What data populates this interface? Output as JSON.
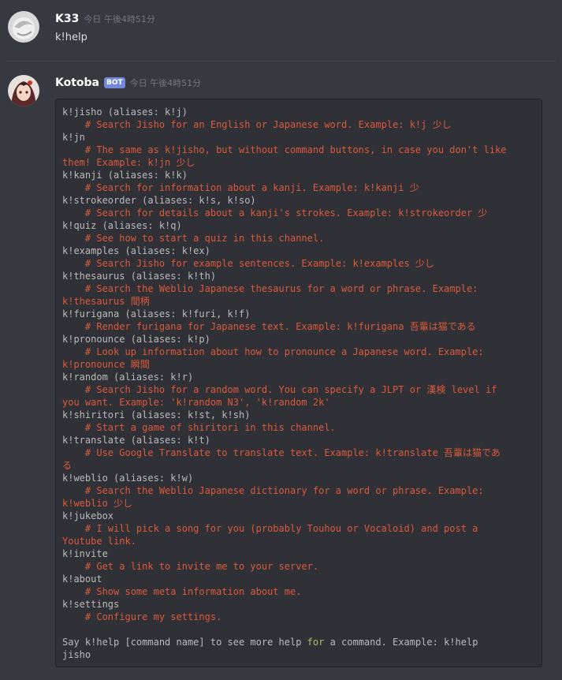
{
  "messages": [
    {
      "username": "K33",
      "timestamp": "今日 午後4時51分",
      "text": "k!help"
    },
    {
      "username": "Kotoba",
      "bot_tag": "BOT",
      "timestamp": "今日 午後4時51分"
    }
  ],
  "help": {
    "commands": [
      {
        "cmd": "k!jisho (aliases: k!j)",
        "desc": [
          "    # Search Jisho for an English or Japanese word. Example: k!j 少し"
        ]
      },
      {
        "cmd": "k!jn",
        "desc": [
          "    # The same as k!jisho, but without command buttons, in case you don't like",
          "them! Example: k!jn 少し"
        ]
      },
      {
        "cmd": "k!kanji (aliases: k!k)",
        "desc": [
          "    # Search for information about a kanji. Example: k!kanji 少"
        ]
      },
      {
        "cmd": "k!strokeorder (aliases: k!s, k!so)",
        "desc": [
          "    # Search for details about a kanji's strokes. Example: k!strokeorder 少"
        ]
      },
      {
        "cmd": "k!quiz (aliases: k!q)",
        "desc": [
          "    # See how to start a quiz in this channel."
        ]
      },
      {
        "cmd": "k!examples (aliases: k!ex)",
        "desc": [
          "    # Search Jisho for example sentences. Example: k!examples 少し"
        ]
      },
      {
        "cmd": "k!thesaurus (aliases: k!th)",
        "desc": [
          "    # Search the Weblio Japanese thesaurus for a word or phrase. Example:",
          "k!thesaurus 間柄"
        ]
      },
      {
        "cmd": "k!furigana (aliases: k!furi, k!f)",
        "desc": [
          "    # Render furigana for Japanese text. Example: k!furigana 吾輩は猫である"
        ]
      },
      {
        "cmd": "k!pronounce (aliases: k!p)",
        "desc": [
          "    # Look up information about how to pronounce a Japanese word. Example:",
          "k!pronounce 瞬間"
        ]
      },
      {
        "cmd": "k!random (aliases: k!r)",
        "desc": [
          "    # Search Jisho for a random word. You can specify a JLPT or 漢検 level if",
          "you want. Example: 'k!random N3', 'k!random 2k'"
        ]
      },
      {
        "cmd": "k!shiritori (aliases: k!st, k!sh)",
        "desc": [
          "    # Start a game of shiritori in this channel."
        ]
      },
      {
        "cmd": "k!translate (aliases: k!t)",
        "desc": [
          "    # Use Google Translate to translate text. Example: k!translate 吾輩は猫であ",
          "る"
        ]
      },
      {
        "cmd": "k!weblio (aliases: k!w)",
        "desc": [
          "    # Search the Weblio Japanese dictionary for a word or phrase. Example:",
          "k!weblio 少し"
        ]
      },
      {
        "cmd": "k!jukebox",
        "desc": [
          "    # I will pick a song for you (probably Touhou or Vocaloid) and post a",
          "Youtube link."
        ]
      },
      {
        "cmd": "k!invite",
        "desc": [
          "    # Get a link to invite me to your server."
        ]
      },
      {
        "cmd": "k!about",
        "desc": [
          "    # Show some meta information about me."
        ]
      },
      {
        "cmd": "k!settings",
        "desc": [
          "    # Configure my settings."
        ]
      }
    ],
    "footer": {
      "line1_before": "Say k!help [command name] to see more help ",
      "line1_keyword": "for",
      "line1_after": " a command. Example: k!help",
      "line2": "jisho"
    }
  },
  "colors": {
    "background": "#36393f",
    "codeblock": "#2f3136",
    "comment": "#dc5a3c",
    "keyword": "#b5bd68",
    "bot_tag": "#7289da"
  },
  "icons": {
    "k33_avatar": "avatar-icon",
    "kotoba_avatar": "avatar-icon"
  }
}
